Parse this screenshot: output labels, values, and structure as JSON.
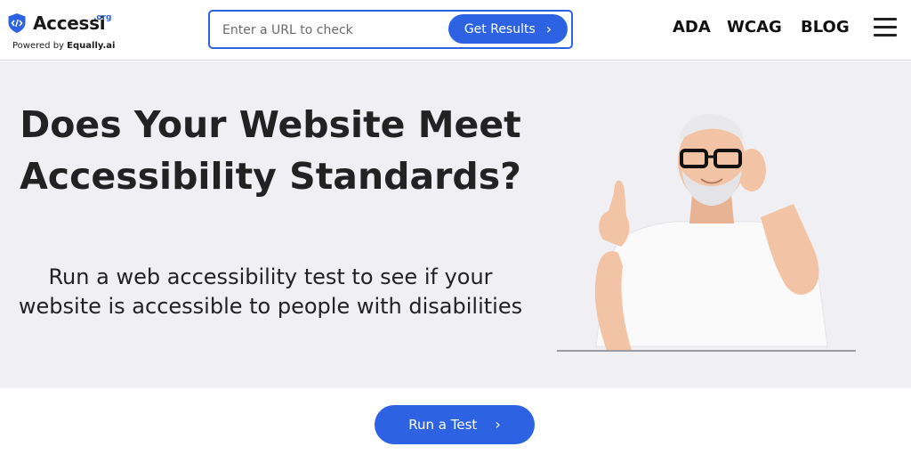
{
  "header": {
    "logo": {
      "name": "Accessi",
      "tld": ".org",
      "powered_prefix": "Powered by",
      "powered_brand": "Equally.ai",
      "icon": "code-shield-icon"
    },
    "search": {
      "placeholder": "Enter a URL to check",
      "value": "",
      "button_label": "Get Results",
      "button_icon": "chevron-right-icon"
    },
    "nav": {
      "items": [
        {
          "label": "ADA"
        },
        {
          "label": "WCAG"
        },
        {
          "label": "BLOG"
        }
      ],
      "menu_icon": "hamburger-menu-icon"
    }
  },
  "hero": {
    "title": "Does Your Website Meet Accessibility Standards?",
    "subtitle": "Run a web accessibility test to see if your website is accessible to people with disabilities",
    "image": "smiling-senior-man-with-glasses-pointing-up"
  },
  "cta": {
    "label": "Run a Test",
    "icon": "chevron-right-icon"
  },
  "colors": {
    "accent": "#2d63e2",
    "hero_background": "#f0f0f4",
    "text": "#222222"
  }
}
